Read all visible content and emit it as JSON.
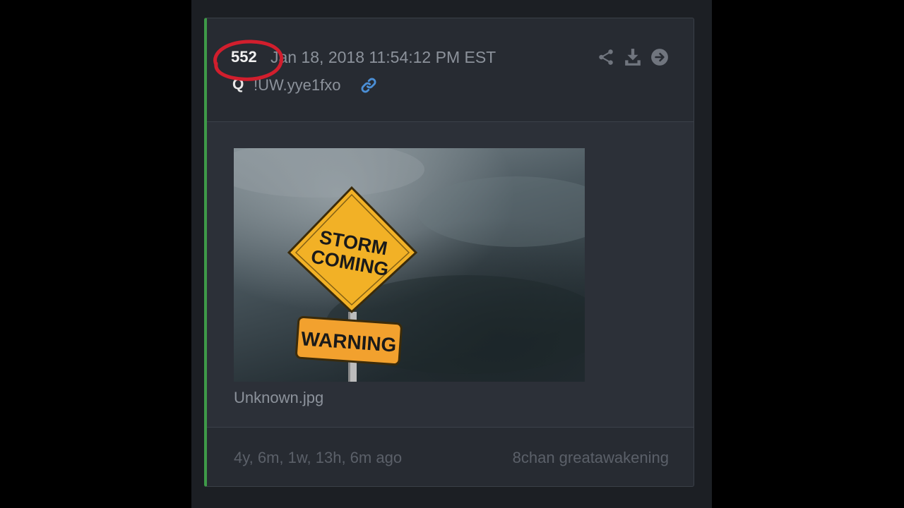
{
  "post": {
    "number": "552",
    "date": "Jan 18, 2018 11:54:12 PM EST",
    "author": "Q",
    "tripcode": "!UW.yye1fxo",
    "attachment": {
      "filename": "Unknown.jpg",
      "sign_top_line1": "STORM",
      "sign_top_line2": "COMING",
      "sign_bottom": "WARNING"
    }
  },
  "footer": {
    "relative_time": "4y, 6m, 1w, 13h, 6m ago",
    "source": "8chan greatawakening"
  },
  "icons": {
    "link": "link-icon",
    "share": "share-icon",
    "download": "download-icon",
    "goto": "arrow-right-circle-icon"
  },
  "colors": {
    "accent_border": "#3e9a48",
    "link_icon": "#4b8fd6",
    "annotation_circle": "#d11e2d"
  }
}
